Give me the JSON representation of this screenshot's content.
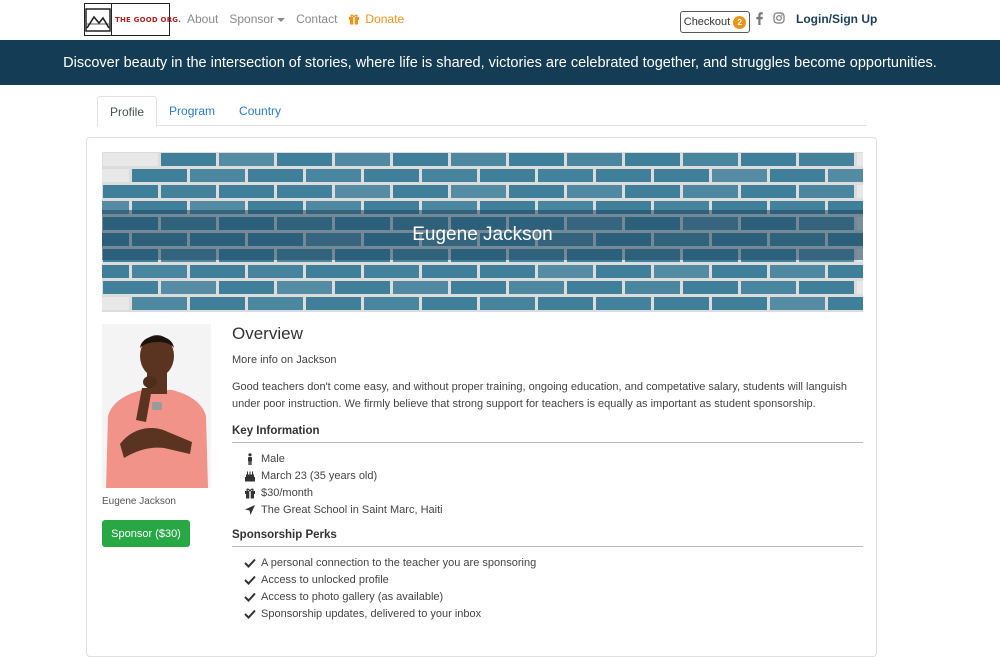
{
  "nav": {
    "brand": "THE GOOD ORG.",
    "links": {
      "about": "About",
      "sponsor": "Sponsor",
      "contact": "Contact",
      "donate": "Donate"
    },
    "checkout_label": "Checkout",
    "checkout_count": "2",
    "login_label": "Login/Sign Up"
  },
  "banner": {
    "text": "Discover beauty in the intersection of stories, where life is shared, victories are celebrated together, and struggles become opportunities."
  },
  "tabs": [
    {
      "label": "Profile",
      "active": true
    },
    {
      "label": "Program",
      "active": false
    },
    {
      "label": "Country",
      "active": false
    }
  ],
  "profile": {
    "name": "Eugene Jackson",
    "photo_caption": "Eugene Jackson",
    "sponsor_button": "Sponsor ($30)",
    "overview_title": "Overview",
    "overview_subtitle": "More info on Jackson",
    "description": "Good teachers don't come easy, and without proper training, ongoing education, and competative salary, students will languish under poor instruction. We firmly believe that strong support for teachers is equally as important as student sponsorship.",
    "key_info_title": "Key Information",
    "key_info": [
      {
        "icon": "person-icon",
        "text": "Male"
      },
      {
        "icon": "birthday-cake-icon",
        "text": "March 23 (35 years old)"
      },
      {
        "icon": "gift-icon",
        "text": "$30/month"
      },
      {
        "icon": "location-arrow-icon",
        "text": "The Great School in Saint Marc, Haiti"
      }
    ],
    "perks_title": "Sponsorship Perks",
    "perks": [
      "A personal connection to the teacher you are sponsoring",
      "Access to unlocked profile",
      "Access to photo gallery (as available)",
      "Sponsorship updates, delivered to your inbox"
    ]
  },
  "colors": {
    "banner_bg": "#143d55",
    "link_blue": "#2a7ac8",
    "donate_orange": "#e8951a",
    "sponsor_green": "#28a745",
    "brick_teal": "#3f7f9a"
  }
}
